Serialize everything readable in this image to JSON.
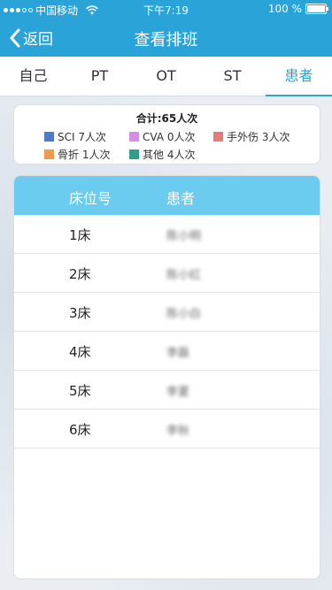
{
  "status_bar": {
    "carrier": "中国移动",
    "time": "下午7:19",
    "battery": "100 %"
  },
  "nav": {
    "back_label": "返回",
    "title": "查看排班"
  },
  "tabs": [
    {
      "label": "自己",
      "active": false
    },
    {
      "label": "PT",
      "active": false
    },
    {
      "label": "OT",
      "active": false
    },
    {
      "label": "ST",
      "active": false
    },
    {
      "label": "患者",
      "active": true
    }
  ],
  "summary": {
    "total": "合计:65人次",
    "legend": [
      {
        "label": "SCI 7人次",
        "color": "#4f79c9"
      },
      {
        "label": "CVA  0人次",
        "color": "#d68de6"
      },
      {
        "label": "手外伤 3人次",
        "color": "#e87a78"
      },
      {
        "label": "骨折 1人次",
        "color": "#ef9a4e"
      },
      {
        "label": "其他 4人次",
        "color": "#2f9e8c"
      }
    ]
  },
  "table": {
    "headers": {
      "bed": "床位号",
      "patient": "患者"
    },
    "rows": [
      {
        "bed": "1床",
        "patient": "陈小明"
      },
      {
        "bed": "2床",
        "patient": "陈小红"
      },
      {
        "bed": "3床",
        "patient": "陈小白"
      },
      {
        "bed": "4床",
        "patient": "李磊"
      },
      {
        "bed": "5床",
        "patient": "李夏"
      },
      {
        "bed": "6床",
        "patient": "李秋"
      }
    ]
  },
  "colors": {
    "accent": "#2aa3d9",
    "table_header": "#6cccef"
  }
}
